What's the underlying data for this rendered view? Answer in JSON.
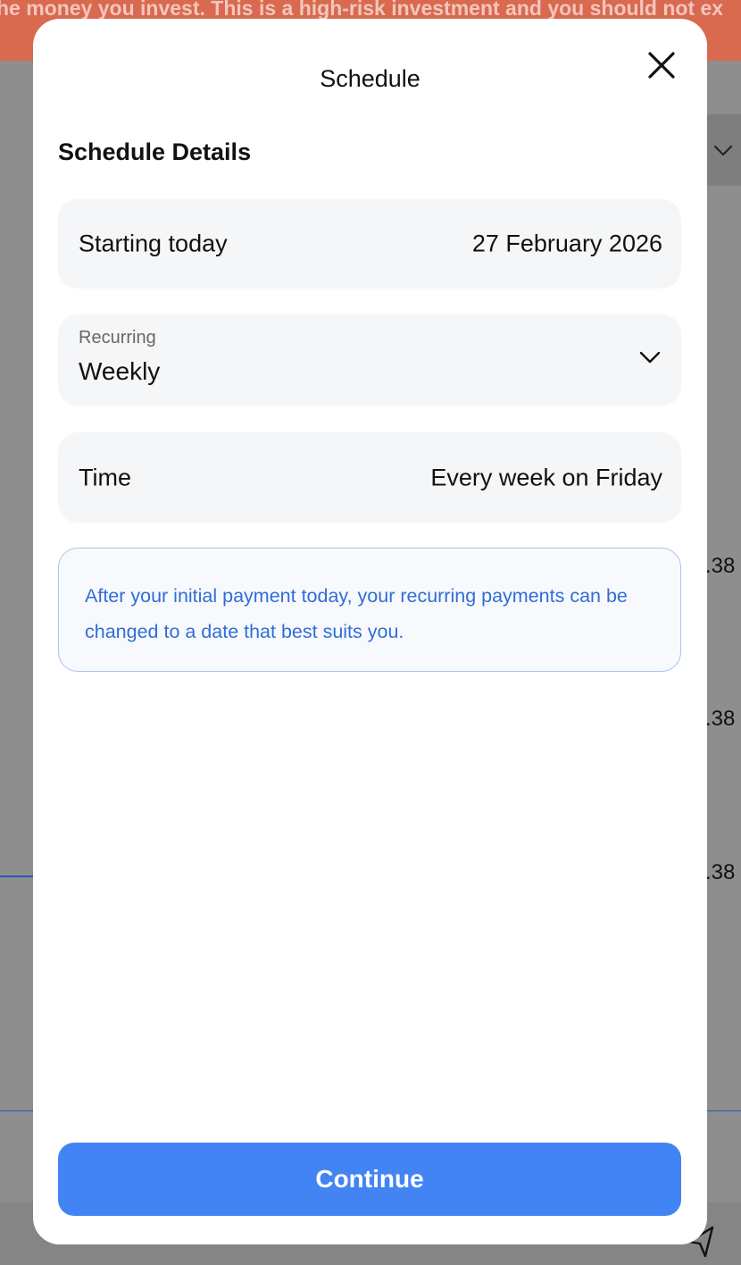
{
  "background": {
    "banner_text": "he money you invest. This is a high-risk investment and you should not ex",
    "values": [
      ".38",
      ".38",
      ".38"
    ],
    "chevron_icon": "chevron-down-icon",
    "send_icon": "send-icon"
  },
  "modal": {
    "title": "Schedule",
    "close_icon": "close-icon",
    "section_title": "Schedule Details",
    "start": {
      "label": "Starting today",
      "value": "27 February 2026"
    },
    "recurring": {
      "label": "Recurring",
      "value": "Weekly",
      "icon": "chevron-down-icon"
    },
    "time": {
      "label": "Time",
      "value": "Every week on Friday"
    },
    "info": "After your initial payment today, your recurring payments can be changed to a date that best suits you.",
    "continue_label": "Continue"
  },
  "colors": {
    "banner": "#d9694f",
    "primary_button": "#4284f3",
    "info_text": "#2f6ed8",
    "info_border": "#a9c3ee",
    "row_background": "#f5f6f8"
  }
}
